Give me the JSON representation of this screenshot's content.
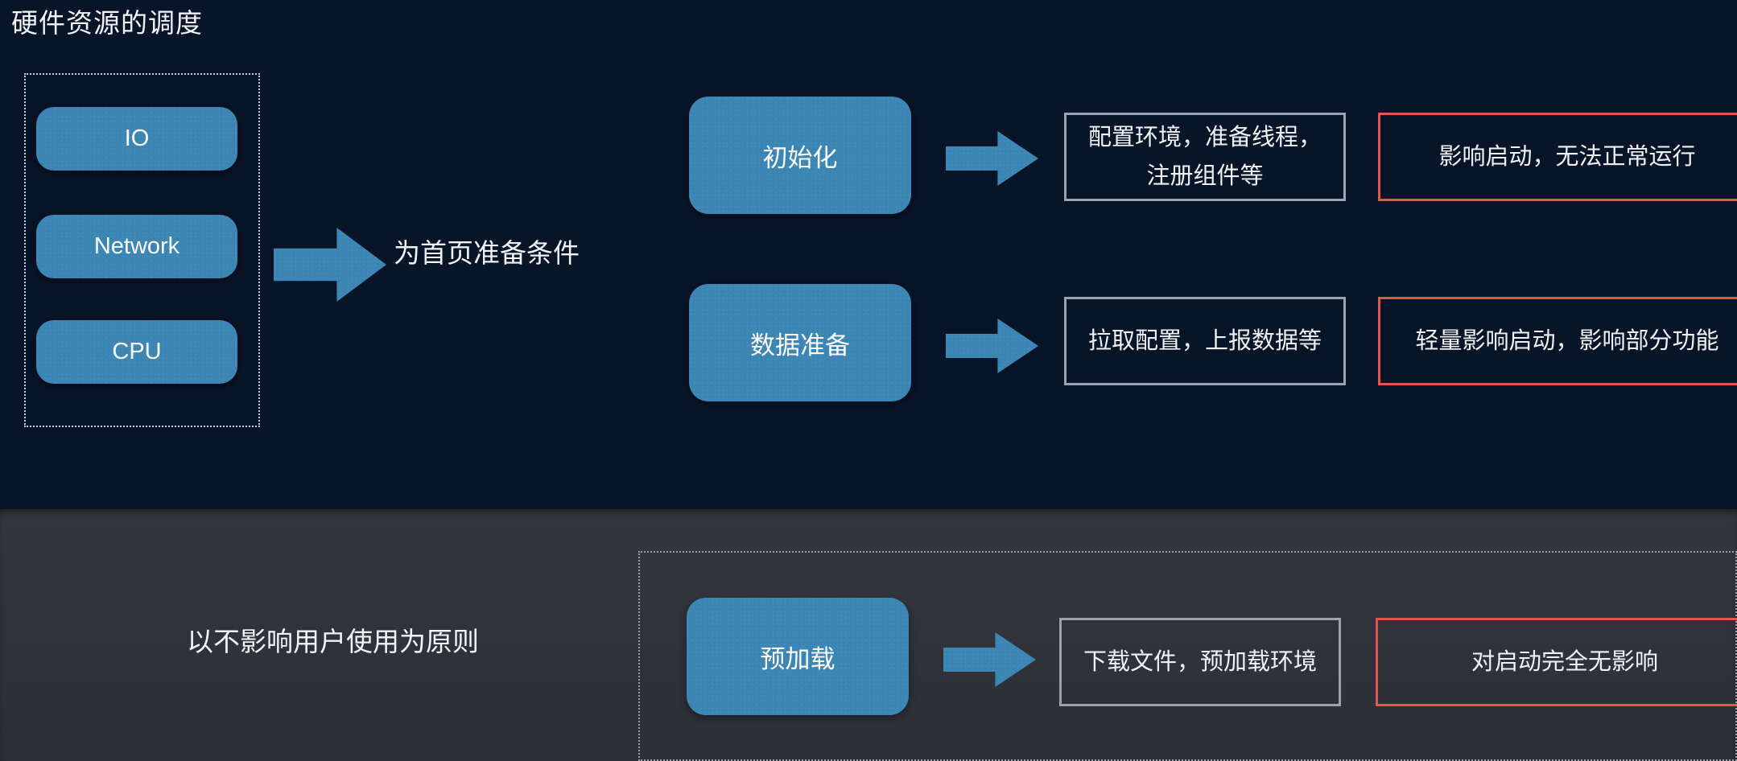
{
  "title": "硬件资源的调度",
  "colors": {
    "background_top": "#081427",
    "background_bottom": "#32353b",
    "chip_blue": "#3b86b4",
    "border_gray": "#9aa4b0",
    "border_red": "#e3564e",
    "text": "#f2f4f7"
  },
  "resource_group": {
    "items": [
      {
        "label": "IO"
      },
      {
        "label": "Network"
      },
      {
        "label": "CPU"
      }
    ]
  },
  "captions": {
    "prepare": "为首页准备条件",
    "principle": "以不影响用户使用为原则"
  },
  "rows": [
    {
      "stage": "初始化",
      "description": "配置环境，准备线程，注册组件等",
      "impact": "影响启动，无法正常运行",
      "impact_severity": "high"
    },
    {
      "stage": "数据准备",
      "description": "拉取配置，上报数据等",
      "impact": "轻量影响启动，影响部分功能",
      "impact_severity": "medium"
    },
    {
      "stage": "预加载",
      "description": "下载文件，预加载环境",
      "impact": "对启动完全无影响",
      "impact_severity": "none"
    }
  ]
}
